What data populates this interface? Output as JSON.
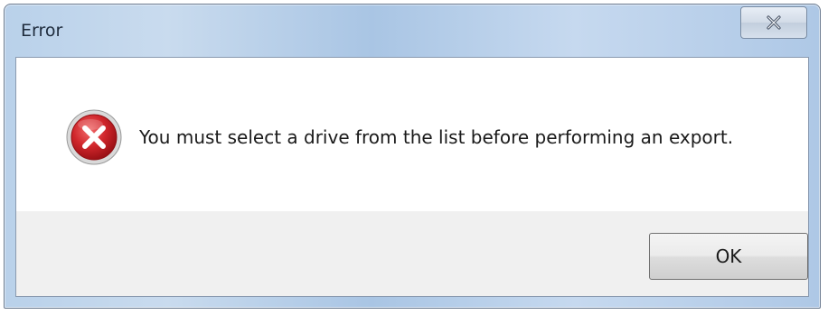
{
  "window": {
    "title": "Error",
    "close_icon": "close-icon"
  },
  "dialog": {
    "icon": "error-icon",
    "message": "You must select a drive from the list before performing an export."
  },
  "buttons": {
    "ok_label": "OK"
  },
  "colors": {
    "title_bar": "#b9d1ea",
    "content_bg": "#ffffff",
    "footer_bg": "#f0f0f0",
    "error_red": "#d0262b"
  }
}
